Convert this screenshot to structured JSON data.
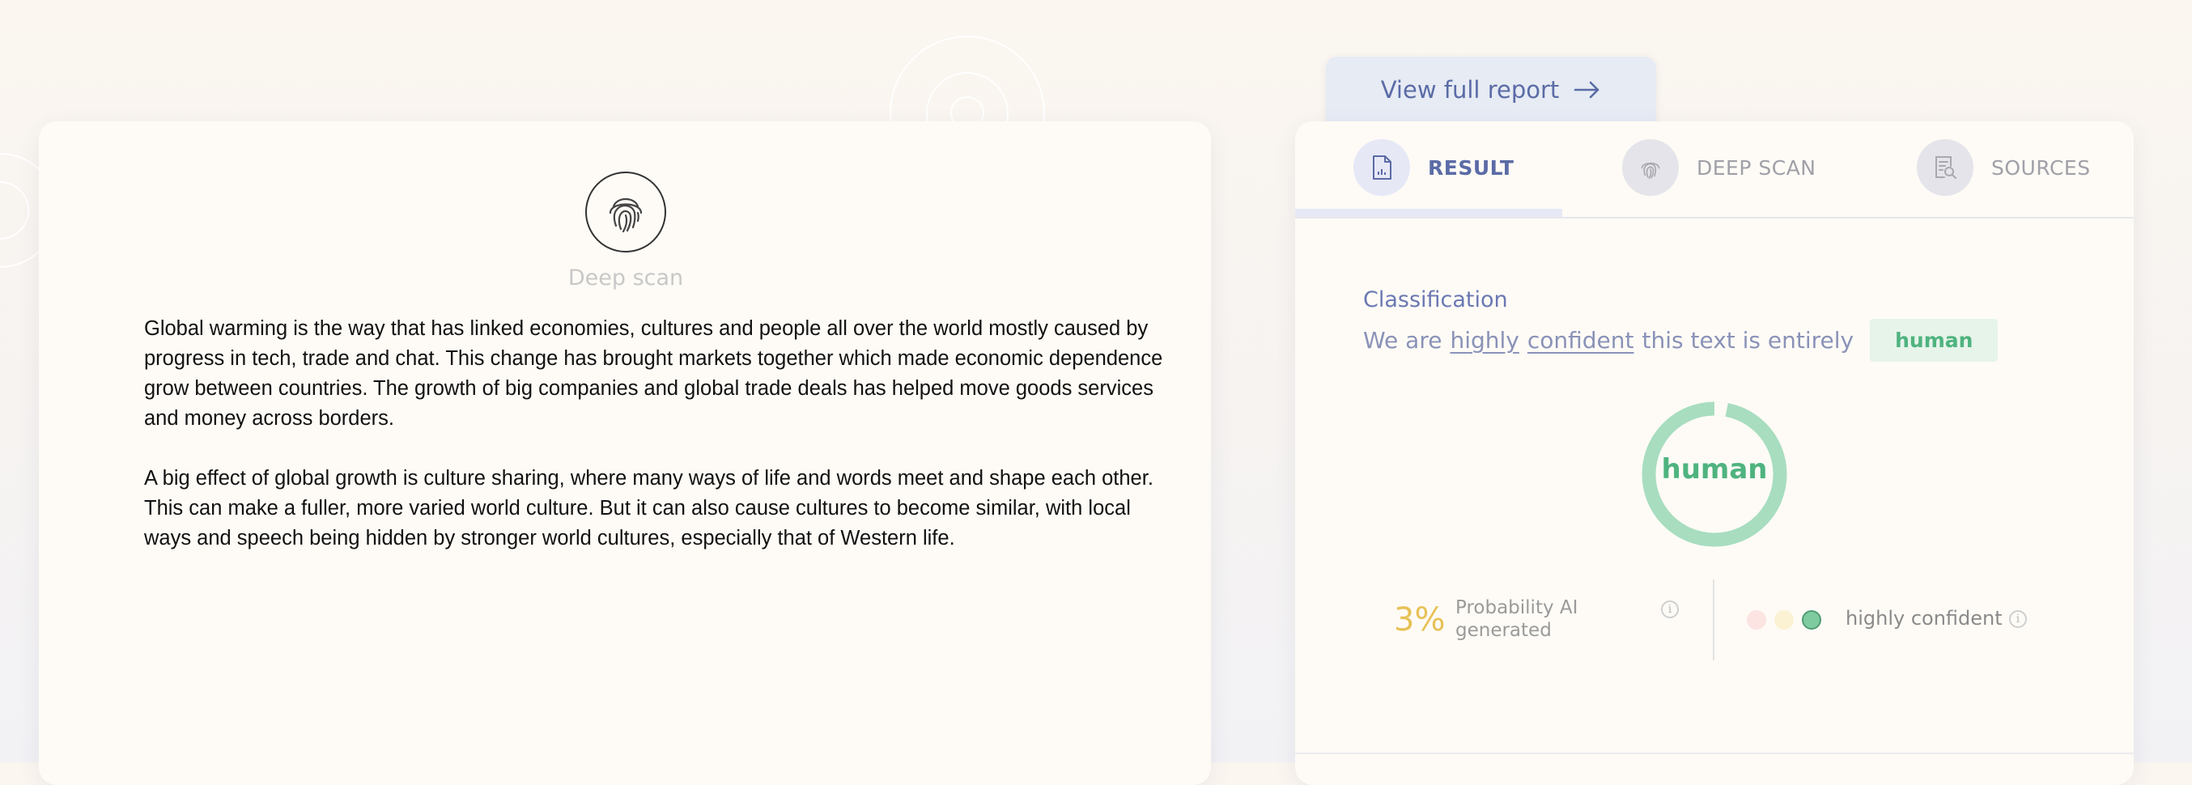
{
  "deep_scan_panel": {
    "label": "Deep scan",
    "paragraphs": [
      "Global warming is the way that has linked economies, cultures and people all over the world mostly caused by progress in tech, trade and chat. This change has brought markets together which made economic dependence grow between countries. The growth of big companies and global trade deals has helped move goods services and money across borders.",
      "A big effect of global growth is culture sharing, where many ways of life and words meet and shape each other. This can make a fuller, more varied world culture. But it can also cause cultures to become similar, with local ways and speech being hidden by stronger world cultures, especially that of Western life."
    ]
  },
  "report_button": {
    "label": "View full report",
    "icon": "arrow-right-icon"
  },
  "tabs": [
    {
      "label": "RESULT",
      "icon": "document-chart-icon",
      "active": true
    },
    {
      "label": "DEEP SCAN",
      "icon": "fingerprint-icon",
      "active": false
    },
    {
      "label": "SOURCES",
      "icon": "document-search-icon",
      "active": false
    }
  ],
  "result": {
    "classification_title": "Classification",
    "sentence_prefix": "We are",
    "word_highly": "highly",
    "word_confident": "confident",
    "sentence_suffix": "this text is entirely",
    "badge": "human",
    "donut_label": "human",
    "donut_fraction_ai": 0.03,
    "probability_value": "3%",
    "probability_label": "Probability AI generated",
    "confidence_label": "highly confident",
    "confidence_level": 3,
    "colors": {
      "human": "#4fb37f",
      "donut_ring": "#a8ddc0",
      "probability": "#e7c156",
      "accent": "#5b6ba6",
      "dot_low": "#fbe4e1",
      "dot_mid": "#fbf2d4",
      "dot_high": "#7fcba0"
    }
  }
}
